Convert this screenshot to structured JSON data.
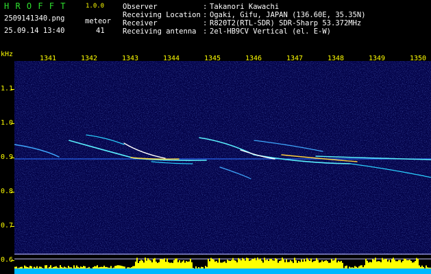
{
  "app": {
    "logo": "H R O F F T",
    "version": "1.0.0"
  },
  "file": {
    "name": "2509141340.png",
    "datetime": "25.09.14 13:40"
  },
  "meteor": {
    "label": "meteor",
    "count": "41"
  },
  "info": [
    {
      "key": "Observer",
      "sep": ":",
      "value": "Takanori Kawachi"
    },
    {
      "key": "Receiving Location",
      "sep": ":",
      "value": "Ogaki, Gifu, JAPAN (136.60E, 35.35N)"
    },
    {
      "key": "Receiver",
      "sep": ":",
      "value": "R820T2(RTL-SDR) SDR-Sharp 53.372MHz"
    },
    {
      "key": "Receiving antenna",
      "sep": ":",
      "value": "2el-HB9CV Vertical (el. E-W)"
    }
  ],
  "axes": {
    "y_unit": "kHz",
    "x_ticks": [
      "1341",
      "1342",
      "1343",
      "1344",
      "1345",
      "1346",
      "1347",
      "1348",
      "1349",
      "1350"
    ],
    "y_ticks": [
      "1.1",
      "1.0",
      "0.9",
      "0.8",
      "0.7",
      "0.6"
    ]
  },
  "colors": {
    "background": "#000000",
    "spectrogram": "#04044a",
    "label": "#ffff00",
    "logo": "#2ee02e",
    "signal": "#4df0ff"
  }
}
